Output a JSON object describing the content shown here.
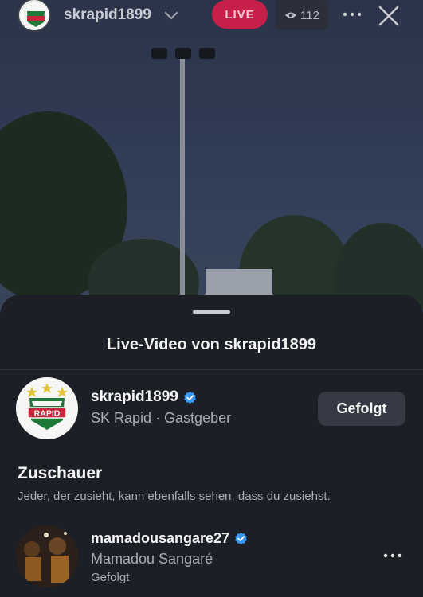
{
  "topbar": {
    "username": "skrapid1899",
    "live_label": "LIVE",
    "viewer_count": "112"
  },
  "sheet": {
    "title": "Live-Video von skrapid1899",
    "host": {
      "username": "skrapid1899",
      "subtitle": "SK Rapid · Gastgeber",
      "follow_label": "Gefolgt",
      "logo_text": "RAPID"
    },
    "viewers_section": {
      "title": "Zuschauer",
      "description": "Jeder, der zusieht, kann ebenfalls sehen, dass du zusiehst."
    },
    "viewers": [
      {
        "username": "mamadousangare27",
        "name": "Mamadou Sangaré",
        "status": "Gefolgt"
      }
    ]
  },
  "colors": {
    "live_red": "#c51f4a",
    "verified_blue": "#3897f0",
    "rapid_green": "#1f7a3a"
  },
  "icons": [
    "chevron-down-icon",
    "eye-icon",
    "more-icon",
    "close-icon",
    "verified-icon"
  ]
}
